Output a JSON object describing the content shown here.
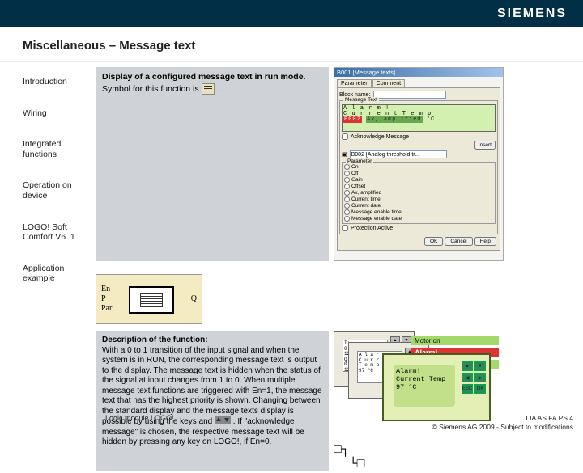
{
  "brand": "SIEMENS",
  "page_title": "Miscellaneous – Message text",
  "sidebar": {
    "items": [
      {
        "label": "Introduction"
      },
      {
        "label": "Wiring"
      },
      {
        "label": "Integrated functions"
      },
      {
        "label": "Operation on device"
      },
      {
        "label": "LOGO! Soft Comfort V6. 1"
      },
      {
        "label": "Application example"
      }
    ]
  },
  "intro": {
    "line1": "Display of a configured message text in run mode.",
    "line2_pre": "Symbol for this function is ",
    "line2_post": " ."
  },
  "dialog": {
    "title": "B001 [Message texts]",
    "tab1": "Parameter",
    "tab2": "Comment",
    "block_name_label": "Block name:",
    "block_name_value": "",
    "msg_group_title": "Message Text",
    "msg_line1": "A l a r m !",
    "msg_line2": "C u r r e n t   T e m p",
    "msg_block_label": "B002",
    "msg_block_sub": "Ax, amplified",
    "msg_unit": "°C",
    "ack_label": "Acknowledge Message",
    "insert_btn": "Insert",
    "param_src_label": "B002 [Analog threshold tr...",
    "params_title": "Parameter",
    "params": [
      "On",
      "Off",
      "Gain",
      "Offset",
      "Ax, amplified",
      "Current time",
      "Current date",
      "Message enable time",
      "Message enable date"
    ],
    "protection_label": "Protection Active",
    "ok": "OK",
    "cancel": "Cancel",
    "help": "Help"
  },
  "wiring": {
    "in1": "En",
    "in2": "P",
    "in3": "Par",
    "out": "Q"
  },
  "description": {
    "heading": "Description of the function:",
    "body": "With a 0 to 1 transition of the input signal and when the system is in RUN, the corresponding message text is output to the display. The message text is hidden when the status of the signal at input changes from 1 to 0. When multiple message text functions are triggered with En=1, the message text that has the highest priority is shown. Changing between the standard display and the message texts display is possible by using the keys and ",
    "body2": ". If \"acknowledge message\" is chosen, the respective message text will be hidden by pressing any key on LOGO!, if En=0."
  },
  "devices": {
    "small1_lines": [
      "I:",
      "0..           5",
      "123456   890",
      "Q:",
      "0..           9",
      "123456789 0"
    ],
    "small2_lines": [
      "A l a r m !",
      "C u r r e n t   T e m p",
      "97 °C"
    ],
    "stat_motor": "Motor on",
    "stat_alarm": "Alarm!",
    "stat_temp": "Current Temp",
    "big_lines": [
      "Alarm!",
      "Current Temp",
      "  97 °C"
    ],
    "big_btns": [
      "▲",
      "▼",
      "◀",
      "▶",
      "ESC",
      "OK"
    ],
    "small_btns": [
      "▲",
      "▼",
      "◀",
      "▶",
      "ESC",
      "OK"
    ],
    "conn": "□┐\n  └□"
  },
  "footer": {
    "left": "Logic module LOGO!",
    "right1": "I IA AS FA PS 4",
    "right2": "© Siemens AG 2009 - Subject to modifications"
  }
}
